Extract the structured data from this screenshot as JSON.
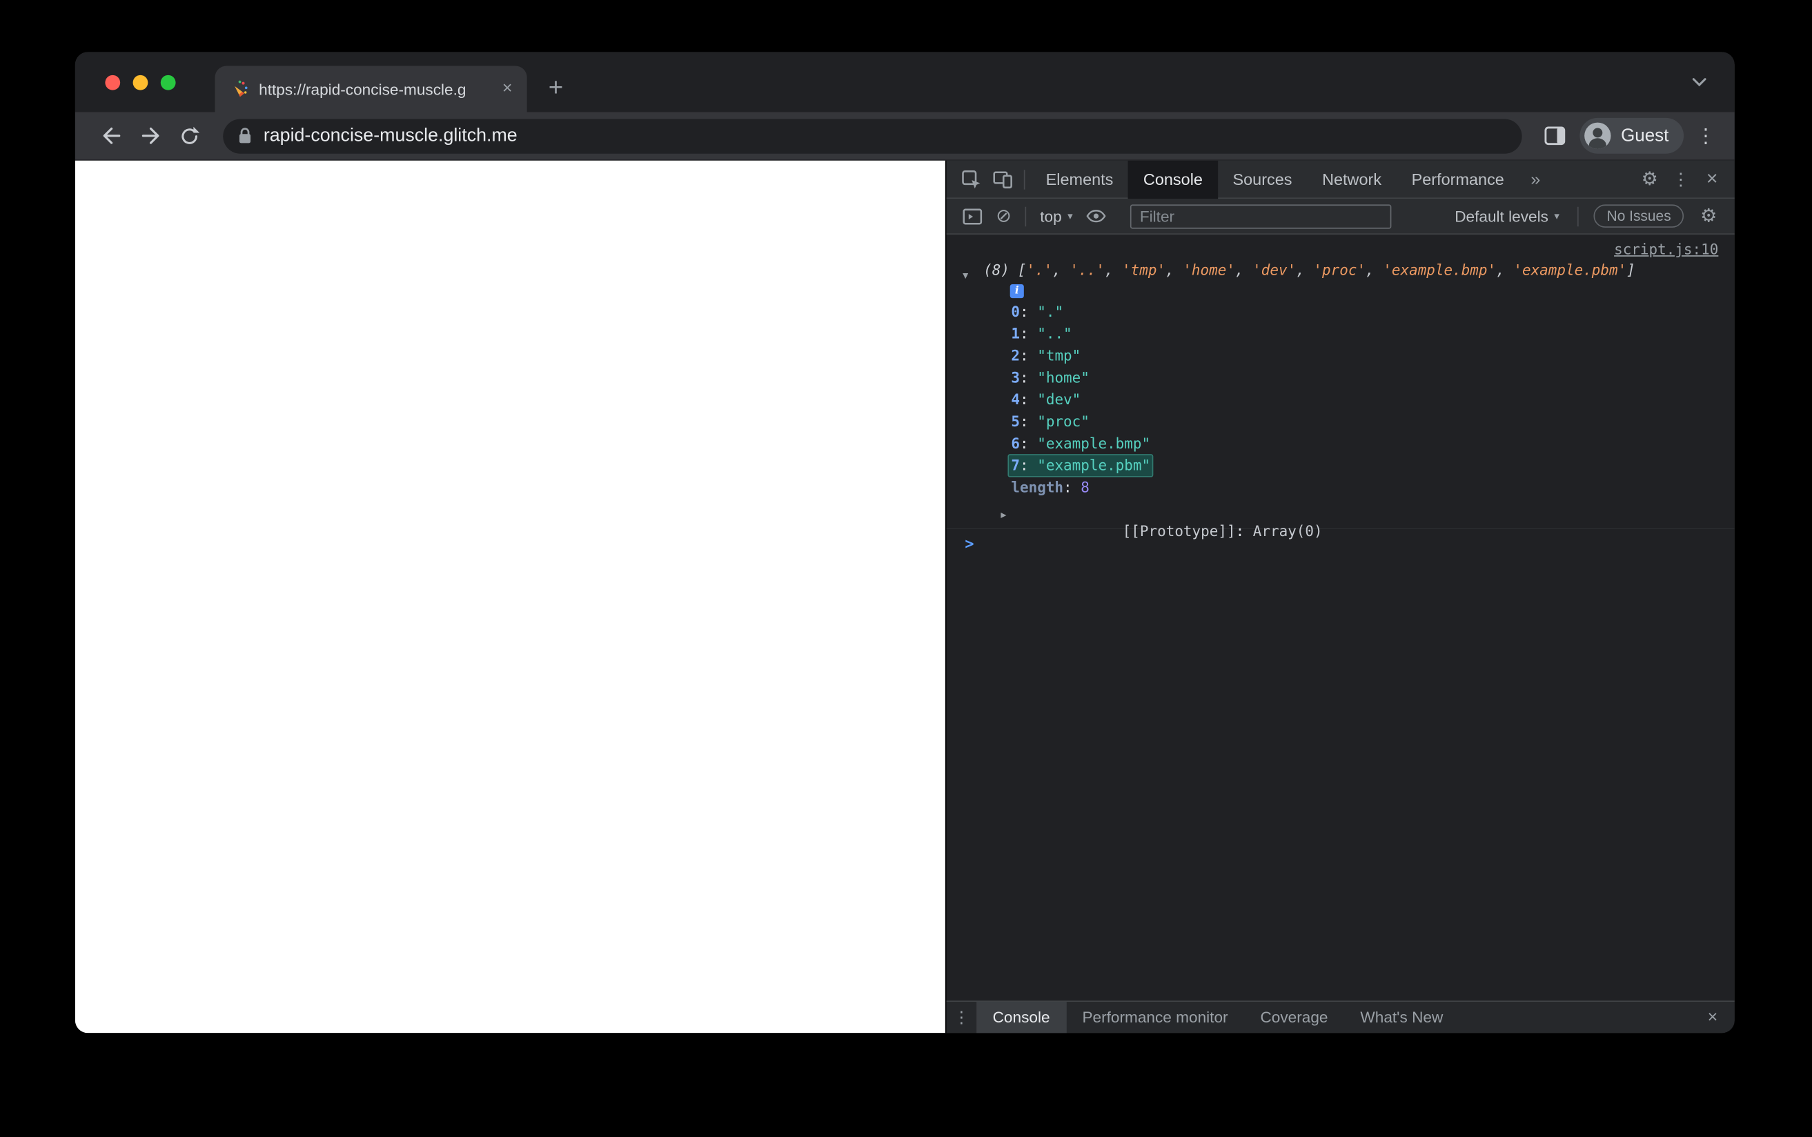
{
  "browser": {
    "tab_title": "https://rapid-concise-muscle.g",
    "url": "rapid-concise-muscle.glitch.me",
    "profile_label": "Guest"
  },
  "icons": {
    "close": "×",
    "plus": "+",
    "more_tabs": "»",
    "overflow": "⋮",
    "gear": "⚙",
    "caret": "▾",
    "block": "⊘",
    "expand_open": "▼",
    "expand_closed": "▶"
  },
  "devtools": {
    "tabs": [
      "Elements",
      "Console",
      "Sources",
      "Network",
      "Performance"
    ],
    "toolbar": {
      "context_label": "top",
      "filter_placeholder": "Filter",
      "levels_label": "Default levels",
      "issues_label": "No Issues"
    },
    "console": {
      "source_link": "script.js:10",
      "colon": ": ",
      "prompt": ">",
      "info_badge": "i",
      "preview": {
        "count": "(8)",
        "bracket_open": "[",
        "bracket_close": "]",
        "sep": ", ",
        "items": [
          "'.'",
          "'..'",
          "'tmp'",
          "'home'",
          "'dev'",
          "'proc'",
          "'example.bmp'",
          "'example.pbm'"
        ]
      },
      "entries": [
        {
          "key": "0",
          "value": "\".\""
        },
        {
          "key": "1",
          "value": "\"..\""
        },
        {
          "key": "2",
          "value": "\"tmp\""
        },
        {
          "key": "3",
          "value": "\"home\""
        },
        {
          "key": "4",
          "value": "\"dev\""
        },
        {
          "key": "5",
          "value": "\"proc\""
        },
        {
          "key": "6",
          "value": "\"example.bmp\""
        },
        {
          "key": "7",
          "value": "\"example.pbm\"",
          "highlight": true
        },
        {
          "key": "length",
          "value": "8",
          "dim": true,
          "type": "num"
        }
      ],
      "prototype_row": {
        "label": "[[Prototype]]",
        "value": "Array(0)"
      }
    },
    "drawer": {
      "tabs": [
        "Console",
        "Performance monitor",
        "Coverage",
        "What's New"
      ]
    }
  },
  "colors": {
    "preview_string": "#ed9a62",
    "expanded_string": "#56d1c0",
    "index_name": "#7cacf8",
    "number": "#9a8cfa",
    "highlight_bg": "#1b4a45",
    "prompt_accent": "#5c9dff",
    "toolbar_bg": "#35363a",
    "panel_bg": "#202124"
  }
}
